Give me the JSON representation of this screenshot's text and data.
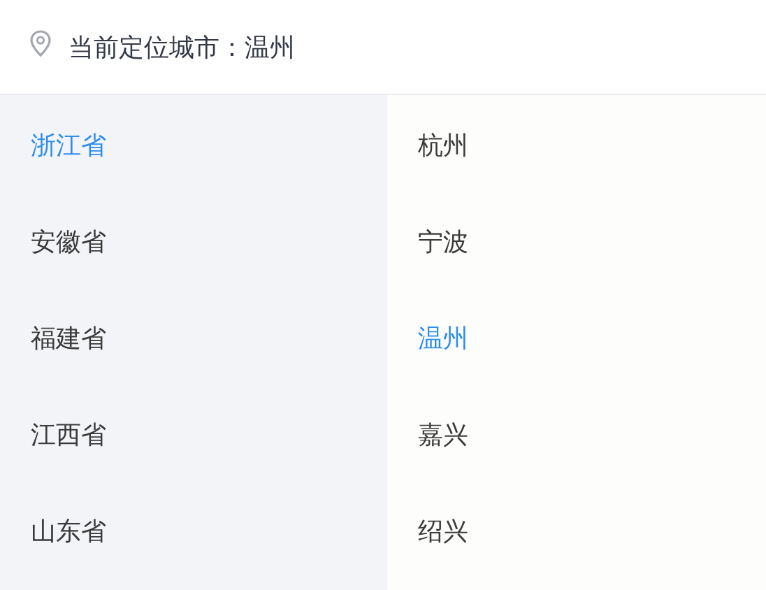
{
  "location_bar": {
    "text": "当前定位城市：温州"
  },
  "provinces": [
    {
      "label": "浙江省",
      "selected": true
    },
    {
      "label": "安徽省",
      "selected": false
    },
    {
      "label": "福建省",
      "selected": false
    },
    {
      "label": "江西省",
      "selected": false
    },
    {
      "label": "山东省",
      "selected": false
    }
  ],
  "cities": [
    {
      "label": "杭州",
      "selected": false
    },
    {
      "label": "宁波",
      "selected": false
    },
    {
      "label": "温州",
      "selected": true
    },
    {
      "label": "嘉兴",
      "selected": false
    },
    {
      "label": "绍兴",
      "selected": false
    }
  ]
}
